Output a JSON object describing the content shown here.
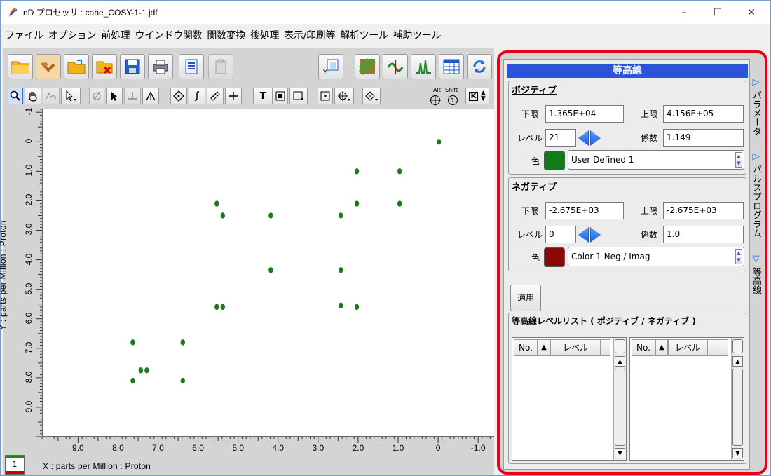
{
  "window": {
    "title": "nD プロセッサ : cahe_COSY-1-1.jdf",
    "controls": [
      "–",
      "☐",
      "✕"
    ]
  },
  "menu": [
    "ファイル",
    "オプション",
    "前処理",
    "ウインドウ関数",
    "関数変換",
    "後処理",
    "表示/印刷等",
    "解析ツール",
    "補助ツール"
  ],
  "toolbar2_text": {
    "t_label": "T",
    "shift_label": "Shift",
    "alt_label": "Alt",
    "k_label": "K"
  },
  "plot": {
    "y_axis_title": "Y : parts per Million : Proton",
    "x_axis_title": "X : parts per Million : Proton",
    "y_ticks": [
      "-1",
      "0",
      "1.0",
      "2.0",
      "3.0",
      "4.0",
      "5.0",
      "6.0",
      "7.0",
      "8.0",
      "9.0"
    ],
    "x_ticks": [
      "9.0",
      "8.0",
      "7.0",
      "6.0",
      "5.0",
      "4.0",
      "3.0",
      "2.0",
      "1.0",
      "0",
      "-1.0"
    ],
    "page_indicator": "1",
    "peak_color": "#1a7a1a"
  },
  "chart_data": {
    "type": "scatter",
    "xlabel": "X : parts per Million : Proton",
    "ylabel": "Y : parts per Million : Proton",
    "xlim": [
      9.9,
      -1.4
    ],
    "ylim": [
      -1.1,
      10.0
    ],
    "x_tick_values": [
      9,
      8,
      7,
      6,
      5,
      4,
      3,
      2,
      1,
      0,
      -1
    ],
    "y_tick_values": [
      -1,
      0,
      1,
      2,
      3,
      4,
      5,
      6,
      7,
      8,
      9
    ],
    "points": [
      {
        "x": 0.0,
        "y": 0.0
      },
      {
        "x": 2.05,
        "y": 1.0
      },
      {
        "x": 0.98,
        "y": 1.0
      },
      {
        "x": 5.55,
        "y": 2.1
      },
      {
        "x": 2.05,
        "y": 2.1
      },
      {
        "x": 0.98,
        "y": 2.1
      },
      {
        "x": 5.4,
        "y": 2.5
      },
      {
        "x": 4.2,
        "y": 2.5
      },
      {
        "x": 2.45,
        "y": 2.5
      },
      {
        "x": 4.2,
        "y": 4.35
      },
      {
        "x": 2.45,
        "y": 4.35
      },
      {
        "x": 5.55,
        "y": 5.6
      },
      {
        "x": 5.4,
        "y": 5.6
      },
      {
        "x": 2.45,
        "y": 5.55
      },
      {
        "x": 2.05,
        "y": 5.6
      },
      {
        "x": 7.65,
        "y": 6.8
      },
      {
        "x": 6.4,
        "y": 6.8
      },
      {
        "x": 7.45,
        "y": 7.75
      },
      {
        "x": 7.3,
        "y": 7.75
      },
      {
        "x": 7.65,
        "y": 8.1
      },
      {
        "x": 6.4,
        "y": 8.1
      }
    ]
  },
  "panel": {
    "header": "等高線",
    "positive": {
      "title": "ポジティブ",
      "lower_label": "下限",
      "lower_value": "1.365E+04",
      "upper_label": "上限",
      "upper_value": "4.156E+05",
      "level_label": "レベル",
      "level_value": "21",
      "factor_label": "係数",
      "factor_value": "1.149",
      "color_label": "色",
      "color_name": "User Defined 1",
      "swatch": "#117a1a"
    },
    "negative": {
      "title": "ネガティブ",
      "lower_label": "下限",
      "lower_value": "-2.675E+03",
      "upper_label": "上限",
      "upper_value": "-2.675E+03",
      "level_label": "レベル",
      "level_value": "0",
      "factor_label": "係数",
      "factor_value": "1.0",
      "color_label": "色",
      "color_name": "Color 1 Neg / Imag",
      "swatch": "#8a0a0a"
    },
    "apply_label": "適用",
    "level_list": {
      "title": "等高線レベルリスト ( ポジティブ / ネガティブ )",
      "col_no": "No.",
      "col_sort": "▲",
      "col_level": "レベル"
    }
  },
  "side_tabs": [
    "パラメータ",
    "パルスプログラム",
    "等高線"
  ]
}
